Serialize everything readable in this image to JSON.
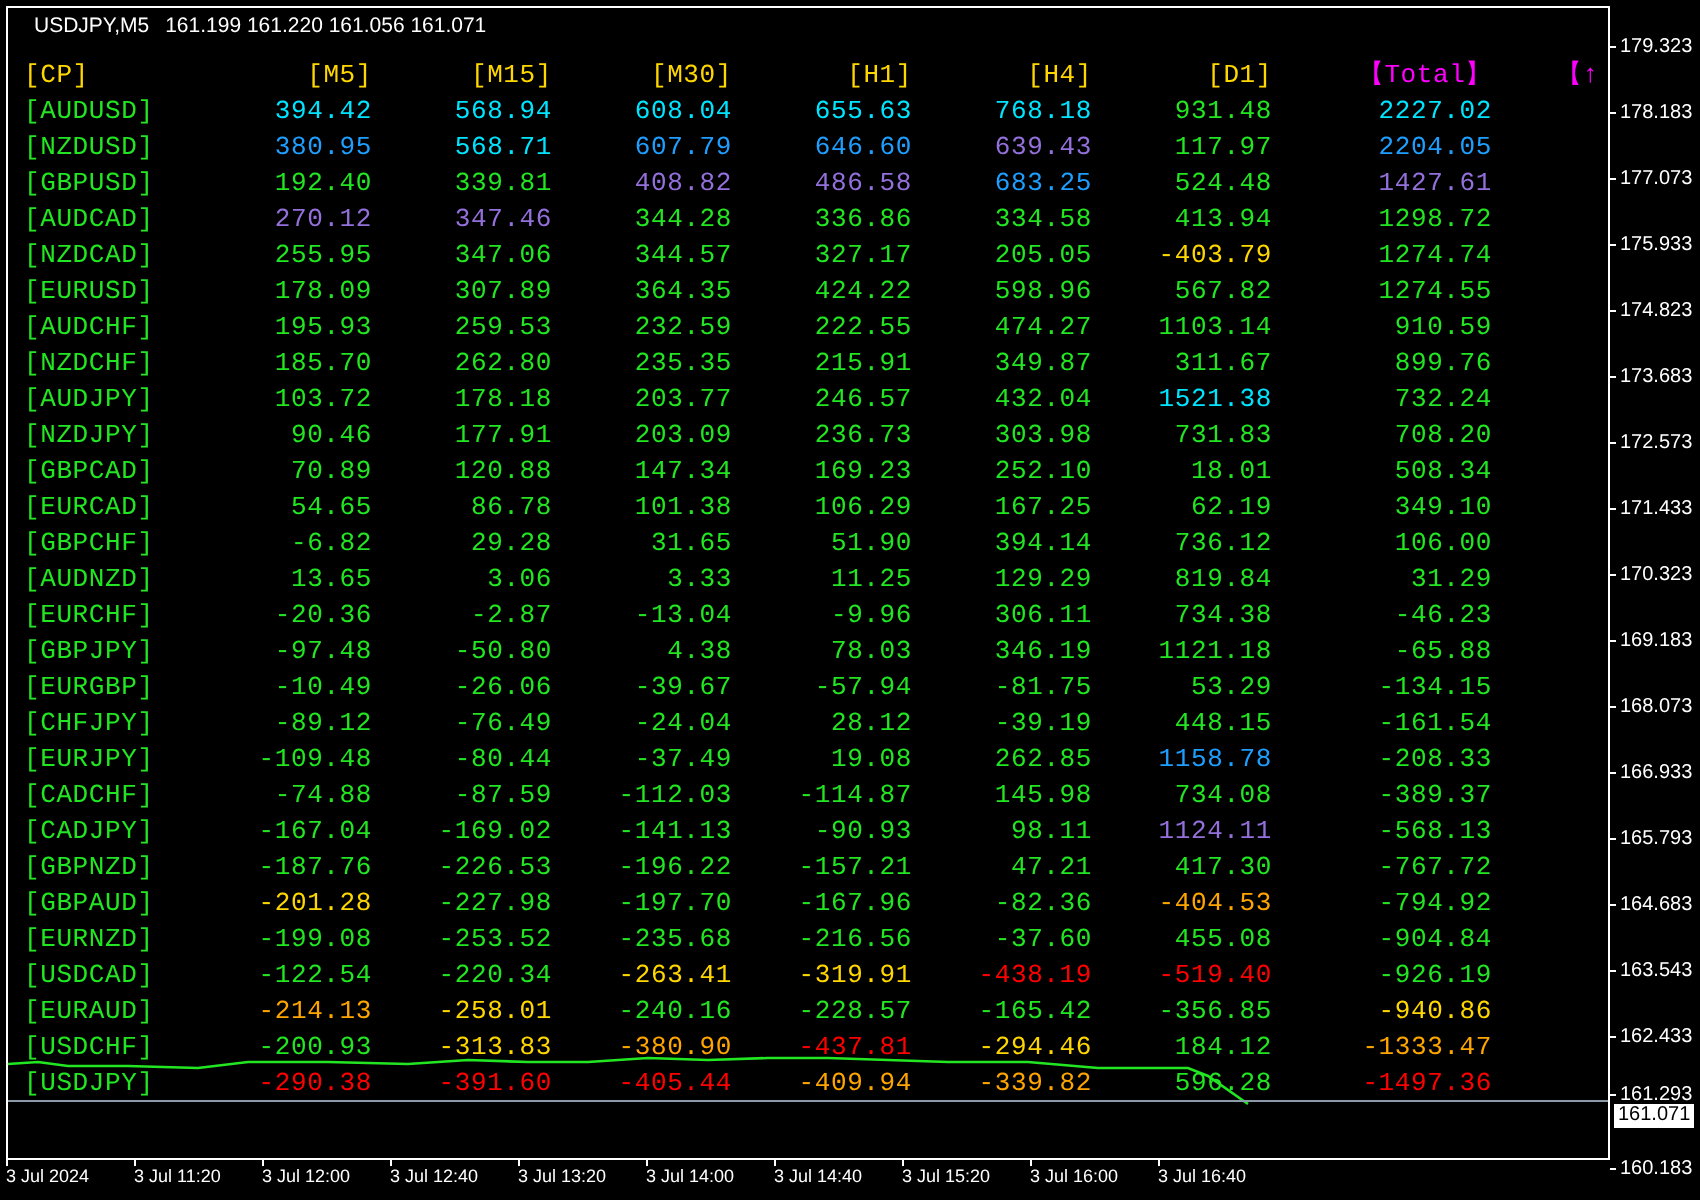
{
  "chart": {
    "symbol": "USDJPY,M5",
    "ohlc": "161.199 161.220 161.056 161.071"
  },
  "table": {
    "columns": [
      {
        "label": "[CP]",
        "color": "#ffd700"
      },
      {
        "label": "[M5]",
        "color": "#ffd700"
      },
      {
        "label": "[M15]",
        "color": "#ffd700"
      },
      {
        "label": "[M30]",
        "color": "#ffd700"
      },
      {
        "label": "[H1]",
        "color": "#ffd700"
      },
      {
        "label": "[H4]",
        "color": "#ffd700"
      },
      {
        "label": "[D1]",
        "color": "#ffd700"
      },
      {
        "label": "【Total】",
        "color": "#ff00ff"
      },
      {
        "label": "【↑",
        "color": "#ff00ff"
      }
    ],
    "rows": [
      {
        "cells": [
          {
            "text": "[AUDUSD]",
            "color": "#22e622"
          },
          {
            "text": "394.42",
            "color": "#00e5ff"
          },
          {
            "text": "568.94",
            "color": "#00e5ff"
          },
          {
            "text": "608.04",
            "color": "#00e5ff"
          },
          {
            "text": "655.63",
            "color": "#00e5ff"
          },
          {
            "text": "768.18",
            "color": "#00e5ff"
          },
          {
            "text": "931.48",
            "color": "#22e622"
          },
          {
            "text": "2227.02",
            "color": "#00e5ff"
          }
        ]
      },
      {
        "cells": [
          {
            "text": "[NZDUSD]",
            "color": "#22e622"
          },
          {
            "text": "380.95",
            "color": "#1e9fff"
          },
          {
            "text": "568.71",
            "color": "#00e5ff"
          },
          {
            "text": "607.79",
            "color": "#1e9fff"
          },
          {
            "text": "646.60",
            "color": "#1e9fff"
          },
          {
            "text": "639.43",
            "color": "#9370db"
          },
          {
            "text": "117.97",
            "color": "#22e622"
          },
          {
            "text": "2204.05",
            "color": "#1e9fff"
          }
        ]
      },
      {
        "cells": [
          {
            "text": "[GBPUSD]",
            "color": "#22e622"
          },
          {
            "text": "192.40",
            "color": "#22e622"
          },
          {
            "text": "339.81",
            "color": "#22e622"
          },
          {
            "text": "408.82",
            "color": "#9370db"
          },
          {
            "text": "486.58",
            "color": "#9370db"
          },
          {
            "text": "683.25",
            "color": "#1e9fff"
          },
          {
            "text": "524.48",
            "color": "#22e622"
          },
          {
            "text": "1427.61",
            "color": "#9370db"
          }
        ]
      },
      {
        "cells": [
          {
            "text": "[AUDCAD]",
            "color": "#22e622"
          },
          {
            "text": "270.12",
            "color": "#9370db"
          },
          {
            "text": "347.46",
            "color": "#9370db"
          },
          {
            "text": "344.28",
            "color": "#22e622"
          },
          {
            "text": "336.86",
            "color": "#22e622"
          },
          {
            "text": "334.58",
            "color": "#22e622"
          },
          {
            "text": "413.94",
            "color": "#22e622"
          },
          {
            "text": "1298.72",
            "color": "#22e622"
          }
        ]
      },
      {
        "cells": [
          {
            "text": "[NZDCAD]",
            "color": "#22e622"
          },
          {
            "text": "255.95",
            "color": "#22e622"
          },
          {
            "text": "347.06",
            "color": "#22e622"
          },
          {
            "text": "344.57",
            "color": "#22e622"
          },
          {
            "text": "327.17",
            "color": "#22e622"
          },
          {
            "text": "205.05",
            "color": "#22e622"
          },
          {
            "text": "-403.79",
            "color": "#ffd700"
          },
          {
            "text": "1274.74",
            "color": "#22e622"
          }
        ]
      },
      {
        "cells": [
          {
            "text": "[EURUSD]",
            "color": "#22e622"
          },
          {
            "text": "178.09",
            "color": "#22e622"
          },
          {
            "text": "307.89",
            "color": "#22e622"
          },
          {
            "text": "364.35",
            "color": "#22e622"
          },
          {
            "text": "424.22",
            "color": "#22e622"
          },
          {
            "text": "598.96",
            "color": "#22e622"
          },
          {
            "text": "567.82",
            "color": "#22e622"
          },
          {
            "text": "1274.55",
            "color": "#22e622"
          }
        ]
      },
      {
        "cells": [
          {
            "text": "[AUDCHF]",
            "color": "#22e622"
          },
          {
            "text": "195.93",
            "color": "#22e622"
          },
          {
            "text": "259.53",
            "color": "#22e622"
          },
          {
            "text": "232.59",
            "color": "#22e622"
          },
          {
            "text": "222.55",
            "color": "#22e622"
          },
          {
            "text": "474.27",
            "color": "#22e622"
          },
          {
            "text": "1103.14",
            "color": "#22e622"
          },
          {
            "text": "910.59",
            "color": "#22e622"
          }
        ]
      },
      {
        "cells": [
          {
            "text": "[NZDCHF]",
            "color": "#22e622"
          },
          {
            "text": "185.70",
            "color": "#22e622"
          },
          {
            "text": "262.80",
            "color": "#22e622"
          },
          {
            "text": "235.35",
            "color": "#22e622"
          },
          {
            "text": "215.91",
            "color": "#22e622"
          },
          {
            "text": "349.87",
            "color": "#22e622"
          },
          {
            "text": "311.67",
            "color": "#22e622"
          },
          {
            "text": "899.76",
            "color": "#22e622"
          }
        ]
      },
      {
        "cells": [
          {
            "text": "[AUDJPY]",
            "color": "#22e622"
          },
          {
            "text": "103.72",
            "color": "#22e622"
          },
          {
            "text": "178.18",
            "color": "#22e622"
          },
          {
            "text": "203.77",
            "color": "#22e622"
          },
          {
            "text": "246.57",
            "color": "#22e622"
          },
          {
            "text": "432.04",
            "color": "#22e622"
          },
          {
            "text": "1521.38",
            "color": "#00e5ff"
          },
          {
            "text": "732.24",
            "color": "#22e622"
          }
        ]
      },
      {
        "cells": [
          {
            "text": "[NZDJPY]",
            "color": "#22e622"
          },
          {
            "text": "90.46",
            "color": "#22e622"
          },
          {
            "text": "177.91",
            "color": "#22e622"
          },
          {
            "text": "203.09",
            "color": "#22e622"
          },
          {
            "text": "236.73",
            "color": "#22e622"
          },
          {
            "text": "303.98",
            "color": "#22e622"
          },
          {
            "text": "731.83",
            "color": "#22e622"
          },
          {
            "text": "708.20",
            "color": "#22e622"
          }
        ]
      },
      {
        "cells": [
          {
            "text": "[GBPCAD]",
            "color": "#22e622"
          },
          {
            "text": "70.89",
            "color": "#22e622"
          },
          {
            "text": "120.88",
            "color": "#22e622"
          },
          {
            "text": "147.34",
            "color": "#22e622"
          },
          {
            "text": "169.23",
            "color": "#22e622"
          },
          {
            "text": "252.10",
            "color": "#22e622"
          },
          {
            "text": "18.01",
            "color": "#22e622"
          },
          {
            "text": "508.34",
            "color": "#22e622"
          }
        ]
      },
      {
        "cells": [
          {
            "text": "[EURCAD]",
            "color": "#22e622"
          },
          {
            "text": "54.65",
            "color": "#22e622"
          },
          {
            "text": "86.78",
            "color": "#22e622"
          },
          {
            "text": "101.38",
            "color": "#22e622"
          },
          {
            "text": "106.29",
            "color": "#22e622"
          },
          {
            "text": "167.25",
            "color": "#22e622"
          },
          {
            "text": "62.19",
            "color": "#22e622"
          },
          {
            "text": "349.10",
            "color": "#22e622"
          }
        ]
      },
      {
        "cells": [
          {
            "text": "[GBPCHF]",
            "color": "#22e622"
          },
          {
            "text": "-6.82",
            "color": "#22e622"
          },
          {
            "text": "29.28",
            "color": "#22e622"
          },
          {
            "text": "31.65",
            "color": "#22e622"
          },
          {
            "text": "51.90",
            "color": "#22e622"
          },
          {
            "text": "394.14",
            "color": "#22e622"
          },
          {
            "text": "736.12",
            "color": "#22e622"
          },
          {
            "text": "106.00",
            "color": "#22e622"
          }
        ]
      },
      {
        "cells": [
          {
            "text": "[AUDNZD]",
            "color": "#22e622"
          },
          {
            "text": "13.65",
            "color": "#22e622"
          },
          {
            "text": "3.06",
            "color": "#22e622"
          },
          {
            "text": "3.33",
            "color": "#22e622"
          },
          {
            "text": "11.25",
            "color": "#22e622"
          },
          {
            "text": "129.29",
            "color": "#22e622"
          },
          {
            "text": "819.84",
            "color": "#22e622"
          },
          {
            "text": "31.29",
            "color": "#22e622"
          }
        ]
      },
      {
        "cells": [
          {
            "text": "[EURCHF]",
            "color": "#22e622"
          },
          {
            "text": "-20.36",
            "color": "#22e622"
          },
          {
            "text": "-2.87",
            "color": "#22e622"
          },
          {
            "text": "-13.04",
            "color": "#22e622"
          },
          {
            "text": "-9.96",
            "color": "#22e622"
          },
          {
            "text": "306.11",
            "color": "#22e622"
          },
          {
            "text": "734.38",
            "color": "#22e622"
          },
          {
            "text": "-46.23",
            "color": "#22e622"
          }
        ]
      },
      {
        "cells": [
          {
            "text": "[GBPJPY]",
            "color": "#22e622"
          },
          {
            "text": "-97.48",
            "color": "#22e622"
          },
          {
            "text": "-50.80",
            "color": "#22e622"
          },
          {
            "text": "4.38",
            "color": "#22e622"
          },
          {
            "text": "78.03",
            "color": "#22e622"
          },
          {
            "text": "346.19",
            "color": "#22e622"
          },
          {
            "text": "1121.18",
            "color": "#22e622"
          },
          {
            "text": "-65.88",
            "color": "#22e622"
          }
        ]
      },
      {
        "cells": [
          {
            "text": "[EURGBP]",
            "color": "#22e622"
          },
          {
            "text": "-10.49",
            "color": "#22e622"
          },
          {
            "text": "-26.06",
            "color": "#22e622"
          },
          {
            "text": "-39.67",
            "color": "#22e622"
          },
          {
            "text": "-57.94",
            "color": "#22e622"
          },
          {
            "text": "-81.75",
            "color": "#22e622"
          },
          {
            "text": "53.29",
            "color": "#22e622"
          },
          {
            "text": "-134.15",
            "color": "#22e622"
          }
        ]
      },
      {
        "cells": [
          {
            "text": "[CHFJPY]",
            "color": "#22e622"
          },
          {
            "text": "-89.12",
            "color": "#22e622"
          },
          {
            "text": "-76.49",
            "color": "#22e622"
          },
          {
            "text": "-24.04",
            "color": "#22e622"
          },
          {
            "text": "28.12",
            "color": "#22e622"
          },
          {
            "text": "-39.19",
            "color": "#22e622"
          },
          {
            "text": "448.15",
            "color": "#22e622"
          },
          {
            "text": "-161.54",
            "color": "#22e622"
          }
        ]
      },
      {
        "cells": [
          {
            "text": "[EURJPY]",
            "color": "#22e622"
          },
          {
            "text": "-109.48",
            "color": "#22e622"
          },
          {
            "text": "-80.44",
            "color": "#22e622"
          },
          {
            "text": "-37.49",
            "color": "#22e622"
          },
          {
            "text": "19.08",
            "color": "#22e622"
          },
          {
            "text": "262.85",
            "color": "#22e622"
          },
          {
            "text": "1158.78",
            "color": "#1e9fff"
          },
          {
            "text": "-208.33",
            "color": "#22e622"
          }
        ]
      },
      {
        "cells": [
          {
            "text": "[CADCHF]",
            "color": "#22e622"
          },
          {
            "text": "-74.88",
            "color": "#22e622"
          },
          {
            "text": "-87.59",
            "color": "#22e622"
          },
          {
            "text": "-112.03",
            "color": "#22e622"
          },
          {
            "text": "-114.87",
            "color": "#22e622"
          },
          {
            "text": "145.98",
            "color": "#22e622"
          },
          {
            "text": "734.08",
            "color": "#22e622"
          },
          {
            "text": "-389.37",
            "color": "#22e622"
          }
        ]
      },
      {
        "cells": [
          {
            "text": "[CADJPY]",
            "color": "#22e622"
          },
          {
            "text": "-167.04",
            "color": "#22e622"
          },
          {
            "text": "-169.02",
            "color": "#22e622"
          },
          {
            "text": "-141.13",
            "color": "#22e622"
          },
          {
            "text": "-90.93",
            "color": "#22e622"
          },
          {
            "text": "98.11",
            "color": "#22e622"
          },
          {
            "text": "1124.11",
            "color": "#9370db"
          },
          {
            "text": "-568.13",
            "color": "#22e622"
          }
        ]
      },
      {
        "cells": [
          {
            "text": "[GBPNZD]",
            "color": "#22e622"
          },
          {
            "text": "-187.76",
            "color": "#22e622"
          },
          {
            "text": "-226.53",
            "color": "#22e622"
          },
          {
            "text": "-196.22",
            "color": "#22e622"
          },
          {
            "text": "-157.21",
            "color": "#22e622"
          },
          {
            "text": "47.21",
            "color": "#22e622"
          },
          {
            "text": "417.30",
            "color": "#22e622"
          },
          {
            "text": "-767.72",
            "color": "#22e622"
          }
        ]
      },
      {
        "cells": [
          {
            "text": "[GBPAUD]",
            "color": "#22e622"
          },
          {
            "text": "-201.28",
            "color": "#ffd700"
          },
          {
            "text": "-227.98",
            "color": "#22e622"
          },
          {
            "text": "-197.70",
            "color": "#22e622"
          },
          {
            "text": "-167.96",
            "color": "#22e622"
          },
          {
            "text": "-82.36",
            "color": "#22e622"
          },
          {
            "text": "-404.53",
            "color": "#ffa500"
          },
          {
            "text": "-794.92",
            "color": "#22e622"
          }
        ]
      },
      {
        "cells": [
          {
            "text": "[EURNZD]",
            "color": "#22e622"
          },
          {
            "text": "-199.08",
            "color": "#22e622"
          },
          {
            "text": "-253.52",
            "color": "#22e622"
          },
          {
            "text": "-235.68",
            "color": "#22e622"
          },
          {
            "text": "-216.56",
            "color": "#22e622"
          },
          {
            "text": "-37.60",
            "color": "#22e622"
          },
          {
            "text": "455.08",
            "color": "#22e622"
          },
          {
            "text": "-904.84",
            "color": "#22e622"
          }
        ]
      },
      {
        "cells": [
          {
            "text": "[USDCAD]",
            "color": "#22e622"
          },
          {
            "text": "-122.54",
            "color": "#22e622"
          },
          {
            "text": "-220.34",
            "color": "#22e622"
          },
          {
            "text": "-263.41",
            "color": "#ffd700"
          },
          {
            "text": "-319.91",
            "color": "#ffd700"
          },
          {
            "text": "-438.19",
            "color": "#ff0000"
          },
          {
            "text": "-519.40",
            "color": "#ff0000"
          },
          {
            "text": "-926.19",
            "color": "#22e622"
          }
        ]
      },
      {
        "cells": [
          {
            "text": "[EURAUD]",
            "color": "#22e622"
          },
          {
            "text": "-214.13",
            "color": "#ffa500"
          },
          {
            "text": "-258.01",
            "color": "#ffd700"
          },
          {
            "text": "-240.16",
            "color": "#22e622"
          },
          {
            "text": "-228.57",
            "color": "#22e622"
          },
          {
            "text": "-165.42",
            "color": "#22e622"
          },
          {
            "text": "-356.85",
            "color": "#22e622"
          },
          {
            "text": "-940.86",
            "color": "#ffd700"
          }
        ]
      },
      {
        "cells": [
          {
            "text": "[USDCHF]",
            "color": "#22e622"
          },
          {
            "text": "-200.93",
            "color": "#22e622"
          },
          {
            "text": "-313.83",
            "color": "#ffd700"
          },
          {
            "text": "-380.90",
            "color": "#ffa500"
          },
          {
            "text": "-437.81",
            "color": "#ff0000"
          },
          {
            "text": "-294.46",
            "color": "#ffd700"
          },
          {
            "text": "184.12",
            "color": "#22e622"
          },
          {
            "text": "-1333.47",
            "color": "#ffa500"
          }
        ]
      },
      {
        "cells": [
          {
            "text": "[USDJPY]",
            "color": "#22e622"
          },
          {
            "text": "-290.38",
            "color": "#ff0000"
          },
          {
            "text": "-391.60",
            "color": "#ff0000"
          },
          {
            "text": "-405.44",
            "color": "#ff0000"
          },
          {
            "text": "-409.94",
            "color": "#ffa500"
          },
          {
            "text": "-339.82",
            "color": "#ffa500"
          },
          {
            "text": "596.28",
            "color": "#22e622"
          },
          {
            "text": "-1497.36",
            "color": "#ff0000"
          }
        ]
      }
    ]
  },
  "price_axis": {
    "labels": [
      "179.323",
      "178.183",
      "177.073",
      "175.933",
      "174.823",
      "173.683",
      "172.573",
      "171.433",
      "170.323",
      "169.183",
      "168.073",
      "166.933",
      "165.793",
      "164.683",
      "163.543",
      "162.433",
      "161.293",
      "160.183"
    ],
    "current_price": "161.071"
  },
  "time_axis": {
    "labels": [
      "3 Jul 2024",
      "3 Jul 11:20",
      "3 Jul 12:00",
      "3 Jul 12:40",
      "3 Jul 13:20",
      "3 Jul 14:00",
      "3 Jul 14:40",
      "3 Jul 15:20",
      "3 Jul 16:00",
      "3 Jul 16:40"
    ]
  }
}
